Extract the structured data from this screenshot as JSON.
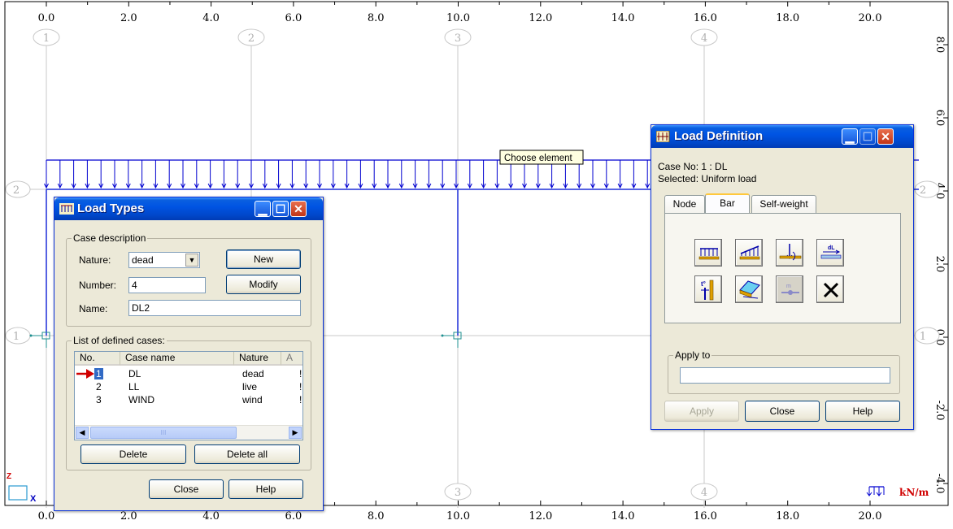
{
  "canvas": {
    "x_ticks": [
      "0.0",
      "2.0",
      "4.0",
      "6.0",
      "8.0",
      "10.0",
      "12.0",
      "14.0",
      "16.0",
      "18.0",
      "20.0"
    ],
    "y_ticks": [
      "8.0",
      "6.0",
      "4.0",
      "2.0",
      "0.0",
      "-2.0",
      "-4.0"
    ],
    "grid_labels_vertical": [
      "1",
      "2",
      "3",
      "4"
    ],
    "grid_labels_horizontal": [
      "1",
      "2"
    ],
    "tooltip": "Choose element",
    "unit_label": "kN/m",
    "axis_x_label": "X",
    "axis_z_label": "Z",
    "load_color": "#0000d0",
    "frame_color": "#1f2fd8"
  },
  "load_types": {
    "title": "Load Types",
    "case_description": "Case description",
    "nature_label": "Nature:",
    "nature_value": "dead",
    "new_button": "New",
    "number_label": "Number:",
    "number_value": "4",
    "modify_button": "Modify",
    "name_label": "Name:",
    "name_value": "DL2",
    "list_group": "List of defined cases:",
    "columns": [
      "No.",
      "Case name",
      "Nature",
      "A"
    ],
    "rows": [
      {
        "no": "1",
        "name": "DL",
        "nature": "dead",
        "extra": "!"
      },
      {
        "no": "2",
        "name": "LL",
        "nature": "live",
        "extra": "!"
      },
      {
        "no": "3",
        "name": "WIND",
        "nature": "wind",
        "extra": "!"
      }
    ],
    "scroll_grip": "III",
    "delete_button": "Delete",
    "delete_all_button": "Delete all",
    "close_button": "Close",
    "help_button": "Help"
  },
  "load_def": {
    "title": "Load Definition",
    "case_info": "Case No: 1 : DL",
    "selected_info": "Selected:  Uniform load",
    "tabs": [
      "Node",
      "Bar",
      "Self-weight"
    ],
    "active_tab": "Bar",
    "apply_to_label": "Apply to",
    "apply_to_value": "",
    "apply_button": "Apply",
    "close_button": "Close",
    "help_button": "Help",
    "tools": [
      "uniform-load",
      "trapezoidal-load",
      "concentrated-force",
      "dilatation-load",
      "thermal-load",
      "surface-load",
      "moving-load",
      "delete-load"
    ]
  }
}
